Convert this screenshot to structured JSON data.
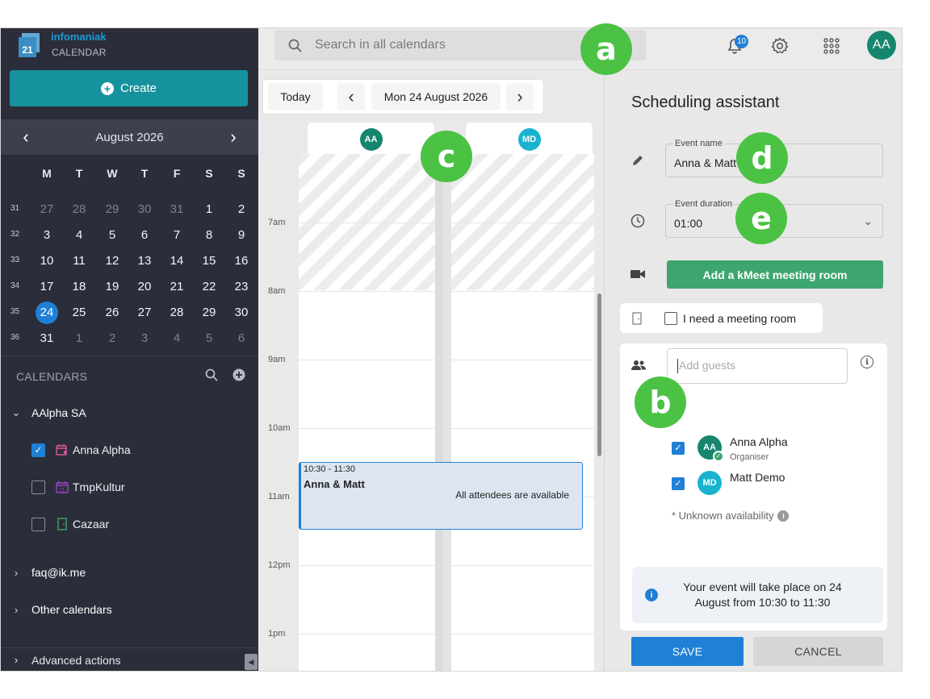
{
  "brand": {
    "name": "infomaniak",
    "product": "CALENDAR",
    "logo_text": "21"
  },
  "sidebar": {
    "create_label": "Create",
    "month_label": "August  2026",
    "weekdays": [
      "M",
      "T",
      "W",
      "T",
      "F",
      "S",
      "S"
    ],
    "weeks": [
      {
        "num": "31",
        "days": [
          "27",
          "28",
          "29",
          "30",
          "31",
          "1",
          "2"
        ]
      },
      {
        "num": "32",
        "days": [
          "3",
          "4",
          "5",
          "6",
          "7",
          "8",
          "9"
        ]
      },
      {
        "num": "33",
        "days": [
          "10",
          "11",
          "12",
          "13",
          "14",
          "15",
          "16"
        ]
      },
      {
        "num": "34",
        "days": [
          "17",
          "18",
          "19",
          "20",
          "21",
          "22",
          "23"
        ]
      },
      {
        "num": "35",
        "days": [
          "24",
          "25",
          "26",
          "27",
          "28",
          "29",
          "30"
        ]
      },
      {
        "num": "36",
        "days": [
          "31",
          "1",
          "2",
          "3",
          "4",
          "5",
          "6"
        ]
      }
    ],
    "selected_day": "24",
    "calendars_heading": "CALENDARS",
    "groups": [
      {
        "label": "AAlpha SA",
        "expanded": true
      },
      {
        "label": "faq@ik.me",
        "expanded": false
      },
      {
        "label": "Other calendars",
        "expanded": false
      }
    ],
    "calendars": [
      {
        "name": "Anna Alpha",
        "checked": true,
        "icon": "calendar-user-icon",
        "color": "#e0559b"
      },
      {
        "name": "TmpKultur",
        "checked": false,
        "icon": "calendar-date-icon",
        "color": "#9a44c8"
      },
      {
        "name": "Cazaar",
        "checked": false,
        "icon": "door-icon",
        "color": "#3da66e"
      }
    ],
    "advanced_label": "Advanced actions"
  },
  "topbar": {
    "search_placeholder": "Search in all calendars",
    "notifications_count": "10",
    "user_initials": "AA"
  },
  "calendar_view": {
    "today_label": "Today",
    "date_label": "Mon 24 August 2026",
    "hours": [
      "7am",
      "8am",
      "9am",
      "10am",
      "11am",
      "12pm",
      "1pm"
    ],
    "columns": [
      {
        "initials": "AA",
        "color": "#16866f"
      },
      {
        "initials": "MD",
        "color": "#19b3d0"
      }
    ],
    "event": {
      "time": "10:30 - 11:30",
      "title": "Anna & Matt",
      "availability": "All attendees are available"
    }
  },
  "panel": {
    "title": "Scheduling assistant",
    "event_name_label": "Event name",
    "event_name_value": "Anna & Matt",
    "duration_label": "Event duration",
    "duration_value": "01:00",
    "kmeet_label": "Add a kMeet meeting room",
    "meeting_room_label": "I need a meeting room",
    "guests_placeholder": "Add guests",
    "attendees": [
      {
        "initials": "AA",
        "name": "Anna Alpha",
        "role": "Organiser",
        "color": "#16866f",
        "checked": true
      },
      {
        "initials": "MD",
        "name": "Matt Demo",
        "role": "",
        "color": "#19b3d0",
        "checked": true
      }
    ],
    "unknown_availability": "* Unknown availability",
    "summary": "Your event will take place on 24 August from 10:30 to 11:30",
    "save_label": "SAVE",
    "cancel_label": "CANCEL"
  },
  "markers": [
    "a",
    "b",
    "c",
    "d",
    "e"
  ]
}
